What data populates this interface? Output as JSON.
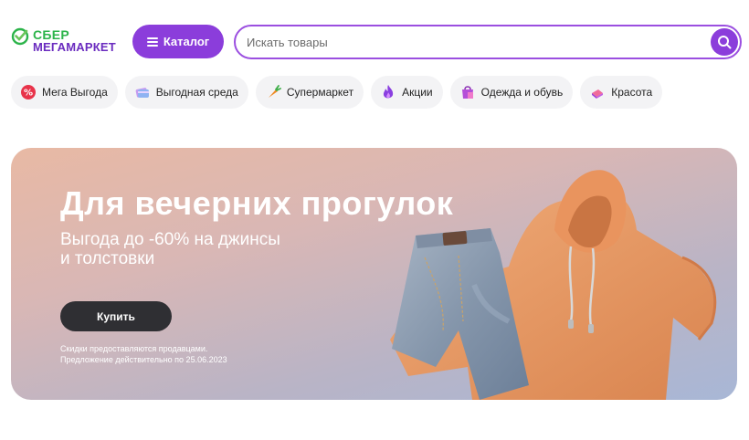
{
  "header": {
    "logo": {
      "top": "СБЕР",
      "bottom": "МЕГАМАРКЕТ"
    },
    "catalog_label": "Каталог",
    "search": {
      "placeholder": "Искать товары",
      "value": ""
    }
  },
  "categories": [
    {
      "label": "Мега Выгода",
      "icon": "percent-badge-icon"
    },
    {
      "label": "Выгодная среда",
      "icon": "gift-card-icon"
    },
    {
      "label": "Супермаркет",
      "icon": "carrot-icon"
    },
    {
      "label": "Акции",
      "icon": "flame-icon"
    },
    {
      "label": "Одежда и обувь",
      "icon": "shopping-bag-icon"
    },
    {
      "label": "Красота",
      "icon": "cosmetics-icon"
    }
  ],
  "banner": {
    "title": "Для вечерних прогулок",
    "subtitle_line1": "Выгода до -60% на джинсы",
    "subtitle_line2": "и толстовки",
    "button_label": "Купить",
    "note_line1": "Скидки предоставляются продавцами.",
    "note_line2": "Предложение действительно по 25.06.2023",
    "image": "jeans-and-hoodie-image"
  },
  "colors": {
    "brand_purple": "#8b3ddb",
    "sber_green": "#2db44b",
    "button_dark": "#2f2f33"
  }
}
